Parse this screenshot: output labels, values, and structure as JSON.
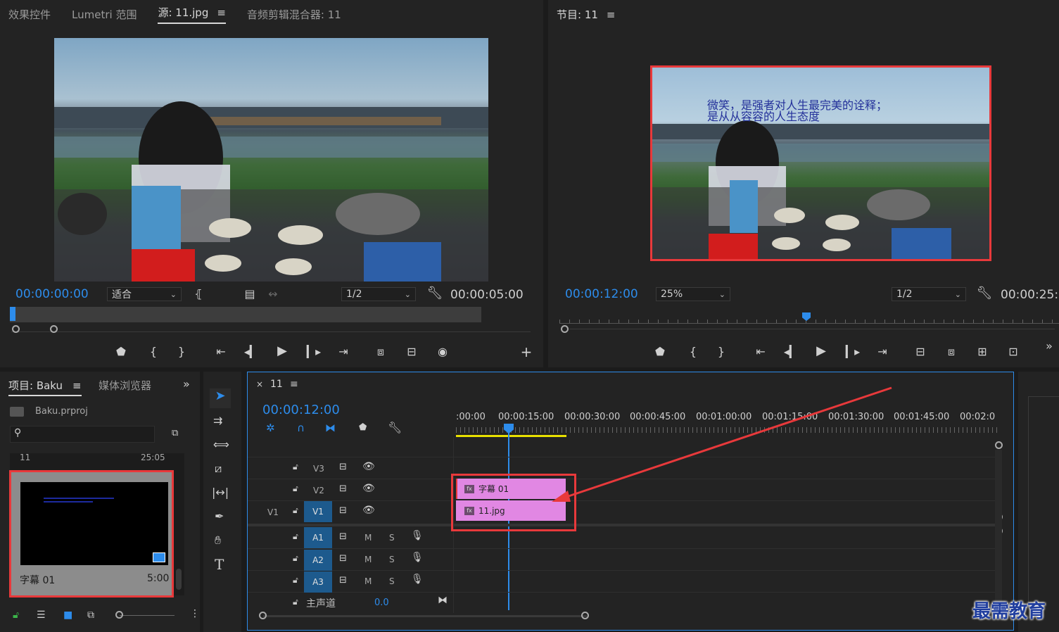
{
  "source_panel": {
    "tabs": [
      "效果控件",
      "Lumetri 范围",
      "源: 11.jpg",
      "音频剪辑混合器: 11"
    ],
    "timecode_current": "00:00:00:00",
    "fit_dropdown": "适合",
    "resolution": "1/2",
    "timecode_duration": "00:00:05:00",
    "playhead_fraction": 0.0
  },
  "program_panel": {
    "title": "节目: 11",
    "timecode_current": "00:00:12:00",
    "zoom": "25%",
    "resolution": "1/2",
    "timecode_duration": "00:00:25:0",
    "caption_line1": "微笑，是强者对人生最完美的诠释；",
    "caption_line2": "是从从容容的人生态度",
    "playhead_fraction": 0.49
  },
  "project_panel": {
    "tabs": [
      "项目: Baku",
      "媒体浏览器"
    ],
    "file_name": "Baku.prproj",
    "items": [
      {
        "name": "11",
        "duration": "25:05"
      },
      {
        "name": "字幕 01",
        "duration": "5:00"
      }
    ]
  },
  "timeline": {
    "sequence_name": "11",
    "timecode": "00:00:12:00",
    "ruler_labels": [
      ":00:00",
      "00:00:15:00",
      "00:00:30:00",
      "00:00:45:00",
      "00:01:00:00",
      "00:01:15:00",
      "00:01:30:00",
      "00:01:45:00",
      "00:02:0"
    ],
    "video_tracks": [
      {
        "label": "V3",
        "source": ""
      },
      {
        "label": "V2",
        "source": ""
      },
      {
        "label": "V1",
        "source": "V1"
      }
    ],
    "audio_tracks": [
      {
        "label": "A1"
      },
      {
        "label": "A2"
      },
      {
        "label": "A3"
      }
    ],
    "mute_label": "M",
    "solo_label": "S",
    "master_label": "主声道",
    "master_value": "0.0",
    "clips": [
      {
        "name": "字幕 01",
        "track": "V2"
      },
      {
        "name": "11.jpg",
        "track": "V1"
      }
    ]
  },
  "watermark": "最需教育",
  "colors": {
    "accent": "#2d8ceb",
    "clip": "#e187e3",
    "highlight": "#e8393b",
    "work_area": "#e8e000"
  },
  "icons": [
    "selection-tool-icon",
    "track-select-icon",
    "ripple-edit-icon",
    "razor-icon",
    "slip-icon",
    "pen-icon",
    "hand-icon",
    "type-icon",
    "wrench-icon",
    "camera-icon",
    "eye-icon",
    "microphone-icon",
    "lock-icon"
  ]
}
